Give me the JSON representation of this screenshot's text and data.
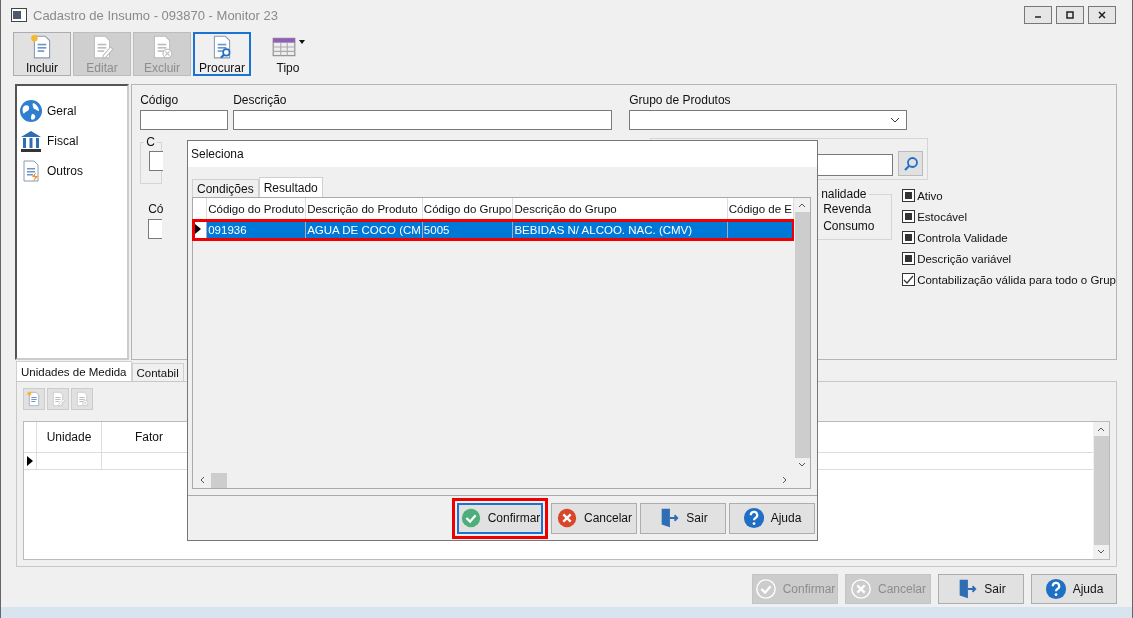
{
  "window": {
    "title": "Cadastro de Insumo - 093870 - Monitor 23"
  },
  "toolbar": [
    {
      "label": "Incluir",
      "kind": "new",
      "disabled": false,
      "focused": false
    },
    {
      "label": "Editar",
      "kind": "edit",
      "disabled": true,
      "focused": false
    },
    {
      "label": "Excluir",
      "kind": "delete",
      "disabled": true,
      "focused": false
    },
    {
      "label": "Procurar",
      "kind": "search",
      "disabled": false,
      "focused": true
    },
    {
      "label": "Tipo",
      "kind": "table",
      "disabled": false,
      "focused": false
    }
  ],
  "sidebar": {
    "items": [
      {
        "label": "Geral",
        "kind": "globe"
      },
      {
        "label": "Fiscal",
        "kind": "bank"
      },
      {
        "label": "Outros",
        "kind": "document"
      }
    ]
  },
  "form": {
    "codigo": {
      "label": "Código"
    },
    "descricao": {
      "label": "Descrição"
    },
    "grupo": {
      "label": "Grupo de Produtos"
    },
    "partial_group_label": "C",
    "partial_field_label": "Có",
    "finalidade": {
      "label": "nalidade",
      "options": [
        "Revenda",
        "Consumo"
      ]
    },
    "checkboxes": [
      {
        "label": "Ativo",
        "checked": true,
        "grayed": true
      },
      {
        "label": "Estocável",
        "checked": true,
        "grayed": true
      },
      {
        "label": "Controla Validade",
        "checked": true,
        "grayed": true
      },
      {
        "label": "Descrição variável",
        "checked": true,
        "grayed": true
      },
      {
        "label": "Contabilização válida para todo o Grup",
        "checked": true,
        "grayed": false
      }
    ]
  },
  "bottom_tabs": [
    {
      "label": "Unidades de Medida",
      "selected": true
    },
    {
      "label": "Contabil",
      "selected": false
    }
  ],
  "units_grid": {
    "columns": [
      "Unidade",
      "Fator"
    ]
  },
  "footer_buttons": [
    {
      "label": "Confirmar",
      "kind": "check",
      "disabled": true
    },
    {
      "label": "Cancelar",
      "kind": "cancel",
      "disabled": true
    },
    {
      "label": "Sair",
      "kind": "exit",
      "disabled": false
    },
    {
      "label": "Ajuda",
      "kind": "help",
      "disabled": false
    }
  ],
  "dialog": {
    "title": "Seleciona",
    "tabs": [
      {
        "label": "Condições",
        "selected": false
      },
      {
        "label": "Resultado",
        "selected": true
      }
    ],
    "columns": [
      "Código do Produto",
      "Descrição do Produto",
      "Código do Grupo",
      "Descrição do Grupo",
      "Código de E"
    ],
    "rows": [
      {
        "cells": [
          "091936",
          "AGUA DE COCO (CM",
          "5005",
          "BEBIDAS N/ ALCOO. NAC. (CMV)"
        ],
        "selected": true,
        "highlighted": true
      }
    ],
    "buttons": [
      {
        "label": "Confirmar",
        "kind": "check",
        "focused": true,
        "highlighted": true
      },
      {
        "label": "Cancelar",
        "kind": "cancel",
        "focused": false,
        "highlighted": false
      },
      {
        "label": "Sair",
        "kind": "exit",
        "focused": false,
        "highlighted": false
      },
      {
        "label": "Ajuda",
        "kind": "help",
        "focused": false,
        "highlighted": false
      }
    ]
  }
}
